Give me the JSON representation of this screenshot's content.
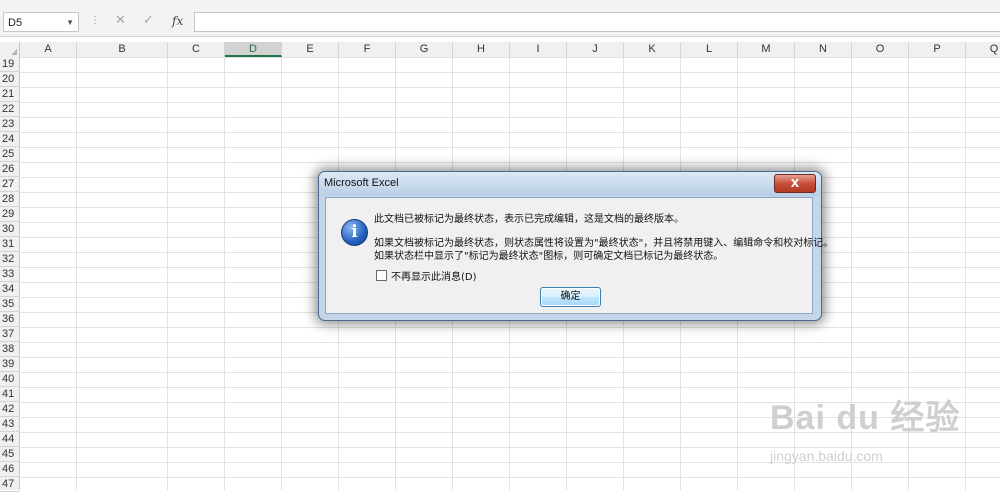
{
  "formula_bar": {
    "name_box": "D5",
    "cancel_symbol": "✕",
    "enter_symbol": "✓",
    "function_symbol": "fx",
    "formula_value": ""
  },
  "columns": [
    "A",
    "B",
    "C",
    "D",
    "E",
    "F",
    "G",
    "H",
    "I",
    "J",
    "K",
    "L",
    "M",
    "N",
    "O",
    "P",
    "Q"
  ],
  "active_column": "D",
  "rows": [
    "19",
    "20",
    "21",
    "22",
    "23",
    "24",
    "25",
    "26",
    "27",
    "28",
    "29",
    "30",
    "31",
    "32",
    "33",
    "34",
    "35",
    "36",
    "37",
    "38",
    "39",
    "40",
    "41",
    "42",
    "43",
    "44",
    "45",
    "46",
    "47"
  ],
  "dialog": {
    "title": "Microsoft Excel",
    "close_symbol": "X",
    "line1": "此文档已被标记为最终状态，表示已完成编辑，这是文档的最终版本。",
    "line2": "如果文档被标记为最终状态，则状态属性将设置为\"最终状态\"，并且将禁用键入、编辑命令和校对标记。",
    "line3": "如果状态栏中显示了\"标记为最终状态\"图标，则可确定文档已标记为最终状态。",
    "checkbox_label": "不再显示此消息(D)",
    "checkbox_checked": false,
    "ok_label": "确定"
  },
  "watermark": {
    "brand": "Bai du 经验",
    "url": "jingyan.baidu.com"
  },
  "colors": {
    "excel_green": "#217346",
    "dialog_frame": "#c4d6ea",
    "info_icon": "#2460c0"
  }
}
